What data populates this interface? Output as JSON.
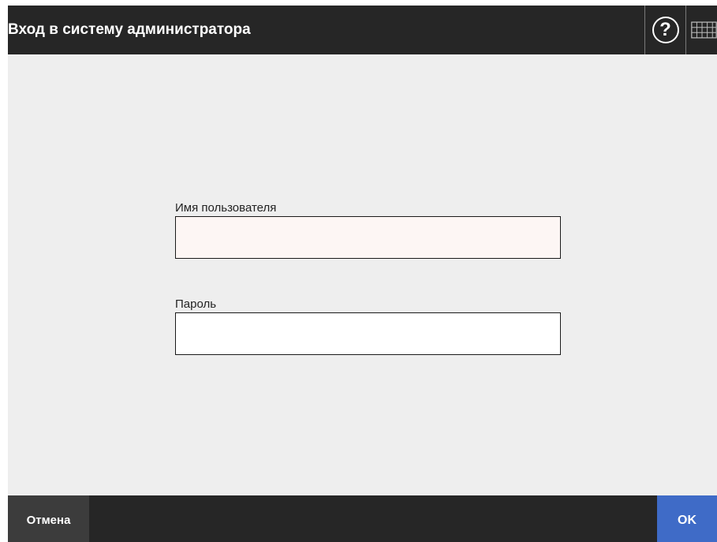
{
  "header": {
    "title": "Вход в систему администратора",
    "help_icon": "help-icon",
    "help_glyph": "?",
    "keyboard_icon": "keyboard-icon"
  },
  "form": {
    "username": {
      "label": "Имя пользователя",
      "value": ""
    },
    "password": {
      "label": "Пароль",
      "value": ""
    }
  },
  "footer": {
    "cancel_label": "Отмена",
    "ok_label": "OK"
  },
  "colors": {
    "header_bg": "#262626",
    "content_bg": "#eeeeee",
    "ok_accent": "#3f6bc7",
    "cancel_bg": "#3c3c3c"
  }
}
